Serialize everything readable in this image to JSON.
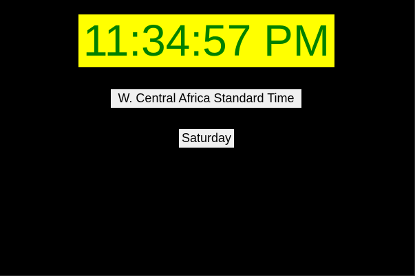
{
  "clock": {
    "time": "11:34:57 PM",
    "timezone": "W. Central Africa Standard Time",
    "day": "Saturday"
  },
  "colors": {
    "background": "#000000",
    "time_background": "#ffff00",
    "time_text": "#008000",
    "label_background": "#f0f0f0",
    "label_text": "#000000"
  }
}
